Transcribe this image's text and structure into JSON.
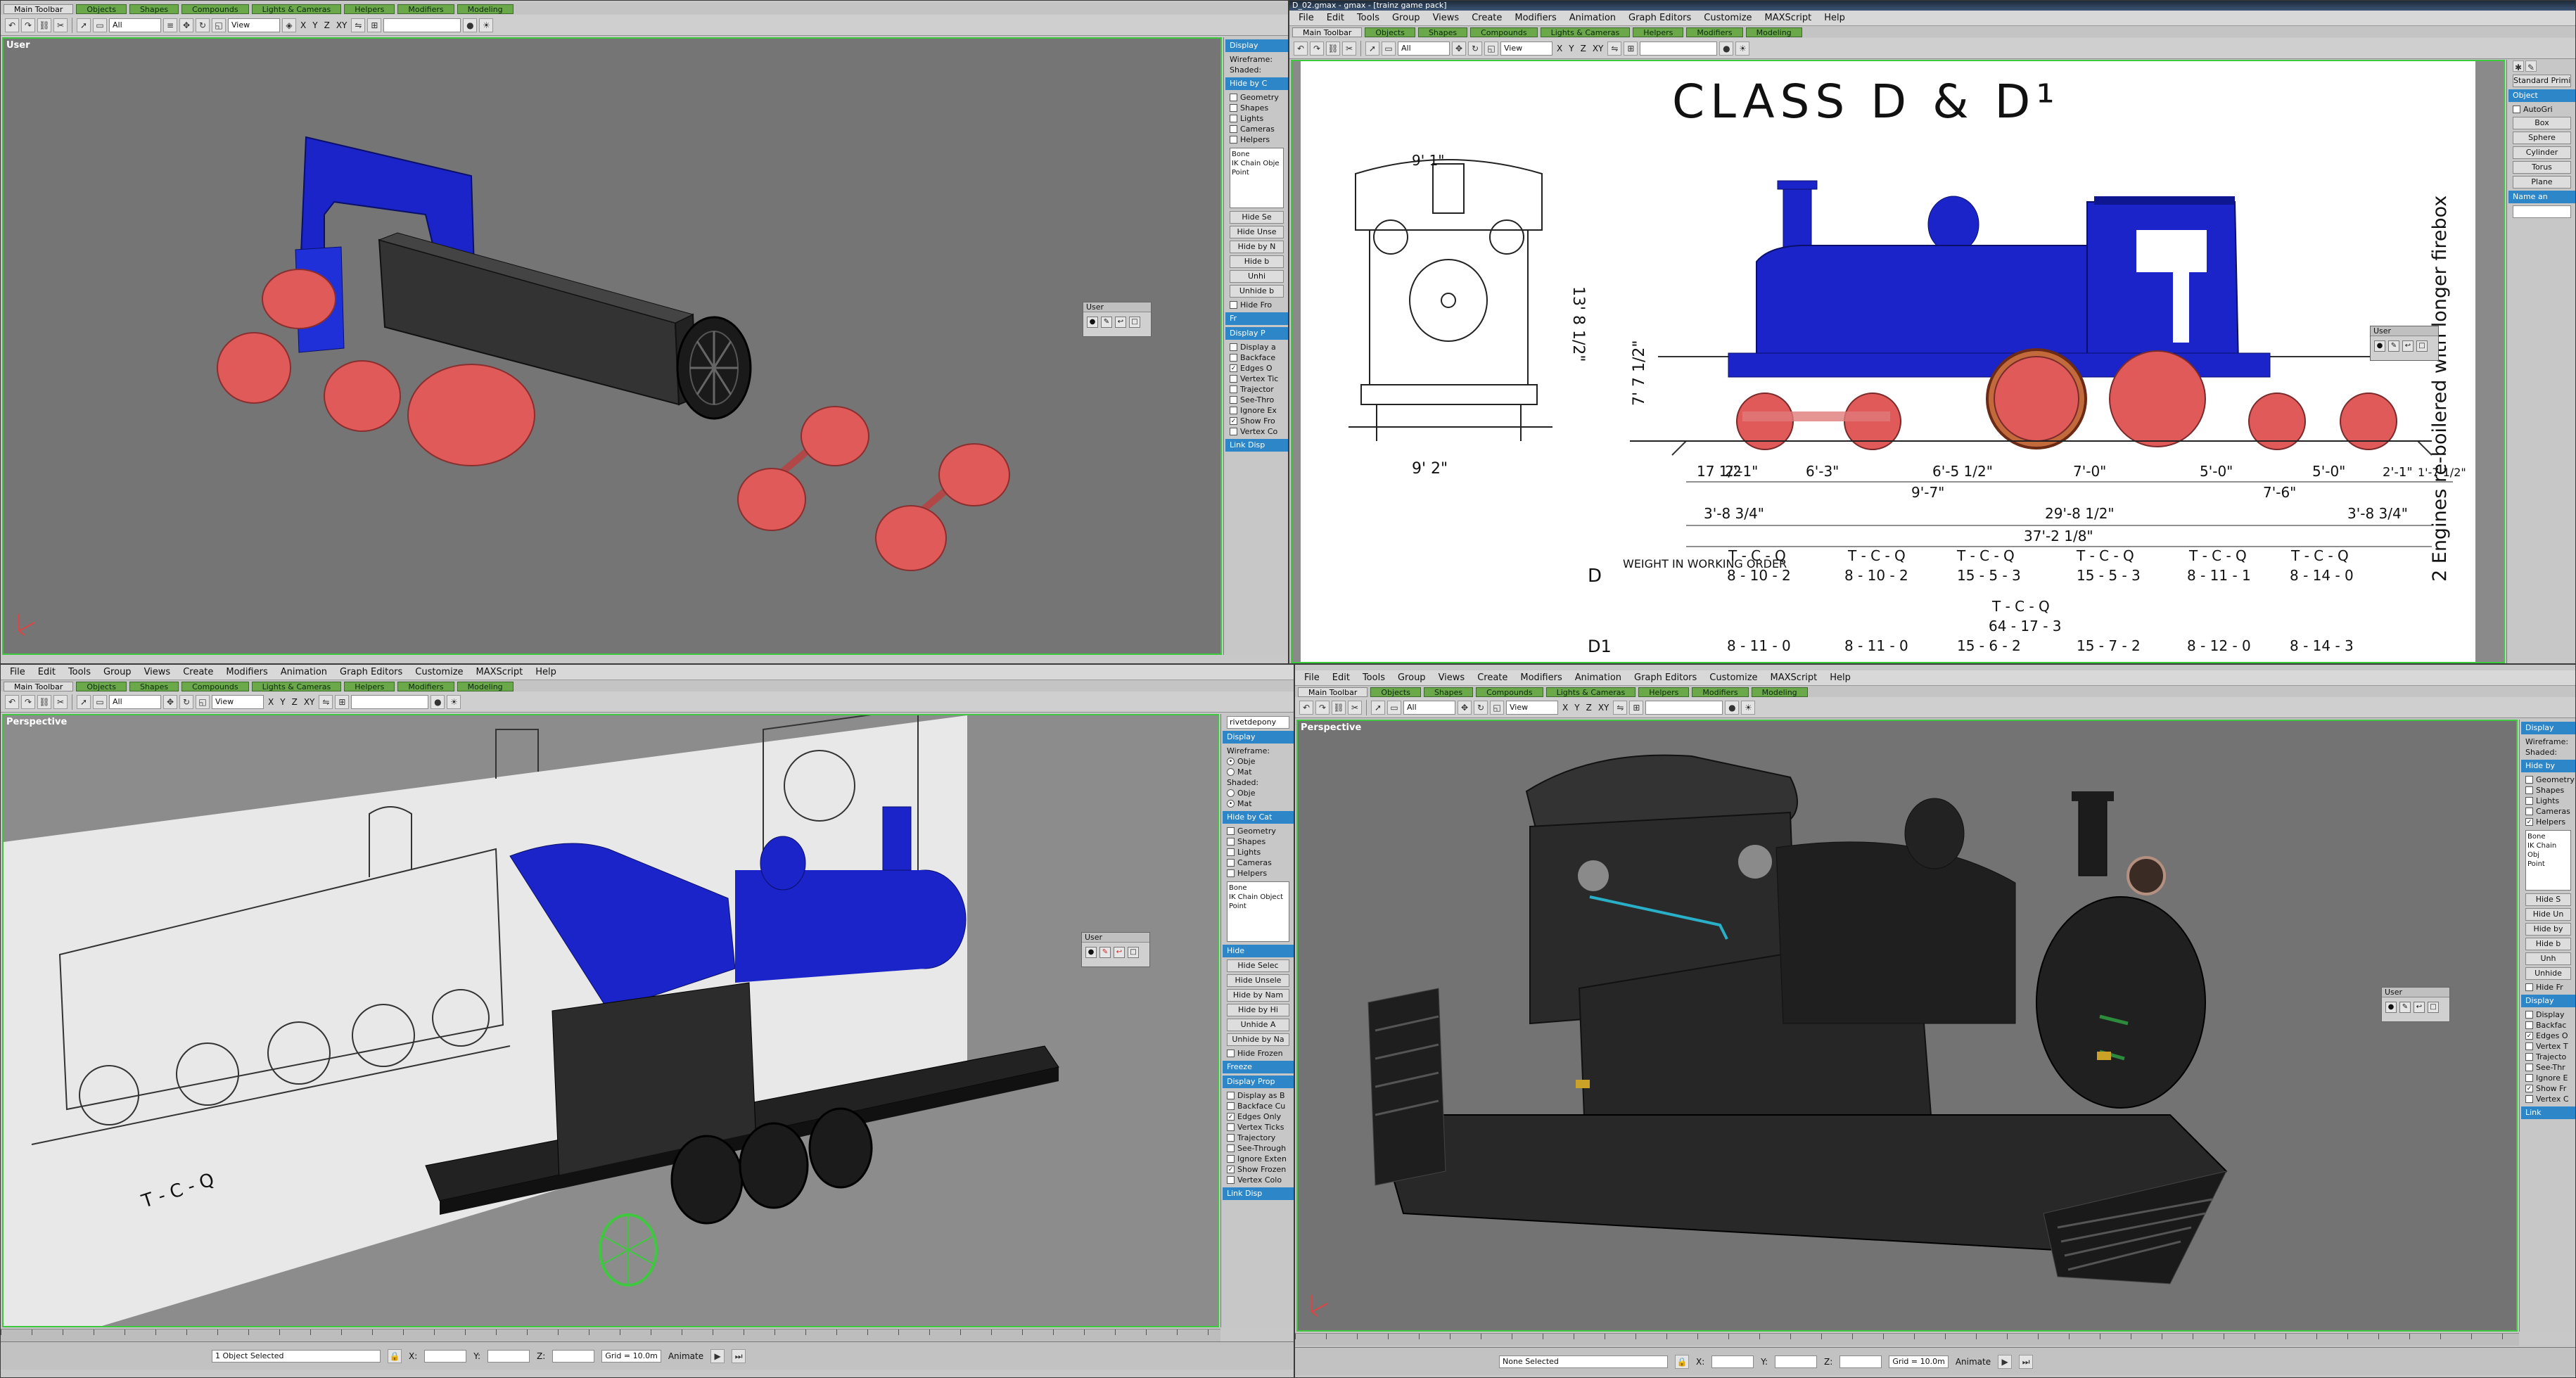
{
  "q1": {
    "tabs": [
      "Main Toolbar",
      "Objects",
      "Shapes",
      "Compounds",
      "Lights & Cameras",
      "Helpers",
      "Modifiers",
      "Modeling"
    ],
    "toolbar": {
      "filter": "All",
      "view": "View",
      "axes": [
        "X",
        "Y",
        "Z",
        "XY"
      ]
    },
    "viewport_label": "User",
    "cmd": {
      "hdr1": "Display",
      "wireframe": "Wireframe:",
      "shaded": "Shaded:",
      "hdr2": "Hide by C",
      "cats": [
        "Geometry",
        "Shapes",
        "Lights",
        "Cameras",
        "Helpers"
      ],
      "list": [
        "Bone",
        "IK Chain Obje",
        "Point"
      ],
      "buttons": [
        "Hide Se",
        "Hide Unse",
        "Hide by N",
        "Hide b",
        "Unhi",
        "Unhide b"
      ],
      "hide_frozen": "Hide Fro",
      "hdr3": "Fr",
      "hdr4": "Display P",
      "props": [
        "Display a",
        "Backface",
        "Edges O",
        "Vertex Tic",
        "Trajector",
        "See-Thro",
        "Ignore Ex",
        "Show Fro",
        "Vertex Co"
      ],
      "props_checked": [
        false,
        false,
        true,
        false,
        false,
        false,
        false,
        true,
        false
      ],
      "hdr5": "Link Disp"
    },
    "float_title": "User"
  },
  "q2": {
    "title": "D_02.gmax - gmax - [trainz game pack]",
    "menu": [
      "File",
      "Edit",
      "Tools",
      "Group",
      "Views",
      "Create",
      "Modifiers",
      "Animation",
      "Graph Editors",
      "Customize",
      "MAXScript",
      "Help"
    ],
    "tabs": [
      "Main Toolbar",
      "Objects",
      "Shapes",
      "Compounds",
      "Lights & Cameras",
      "Helpers",
      "Modifiers",
      "Modeling"
    ],
    "toolbar": {
      "filter": "All",
      "view": "View",
      "axes": [
        "X",
        "Y",
        "Z",
        "XY"
      ]
    },
    "blueprint": {
      "heading": "CLASS  D & D¹",
      "side_note": "2 Engines re-boilered with longer firebox",
      "dims_top": [
        "9' 1\"",
        "13' 8 1/2\"",
        "7' 7 1/2\"",
        "9' 2\""
      ],
      "wheelbase": [
        "17 1/2",
        "2'-1\"",
        "6'-3\"",
        "6'-5 1/2\"",
        "7'-0\"",
        "5'-0\"",
        "5'-0\"",
        "2'-1\"",
        "1'-7 1/2\""
      ],
      "lengths": [
        "9'-7\"",
        "7'-6\"",
        "3'-8 3/4\"",
        "29'-8 1/2\"",
        "37'-2 1/8\"",
        "3'-8 3/4\""
      ],
      "row_d_label": "D",
      "row_d1_label": "D1",
      "weight_label": "WEIGHT IN WORKING ORDER",
      "units": [
        "T - C - Q",
        "T - C - Q",
        "T - C - Q",
        "T - C - Q",
        "T - C - Q",
        "T - C - Q"
      ],
      "d_values": [
        "8 - 10 - 2",
        "8 - 10 - 2",
        "15 - 5 - 3",
        "15 - 5 - 3",
        "8 - 11 - 1",
        "8 - 14 - 0"
      ],
      "total_unit": "T - C - Q",
      "total": "64 - 17 - 3",
      "d1_values": [
        "8 - 11 - 0",
        "8 - 11 - 0",
        "15 - 6 - 2",
        "15 - 7 - 2",
        "8 - 12 - 0",
        "8 - 14 - 3"
      ]
    },
    "cmd": {
      "items": [
        "Standard Primit",
        "Object",
        "AutoGri",
        "Box",
        "Sphere",
        "Cylinder",
        "Torus",
        "Plane",
        "Name an"
      ]
    },
    "float_title": "User"
  },
  "q3": {
    "menu": [
      "File",
      "Edit",
      "Tools",
      "Group",
      "Views",
      "Create",
      "Modifiers",
      "Animation",
      "Graph Editors",
      "Customize",
      "MAXScript",
      "Help"
    ],
    "tabs": [
      "Main Toolbar",
      "Objects",
      "Shapes",
      "Compounds",
      "Lights & Cameras",
      "Helpers",
      "Modifiers",
      "Modeling"
    ],
    "toolbar": {
      "filter": "All",
      "view": "View",
      "axes": [
        "X",
        "Y",
        "Z",
        "XY"
      ]
    },
    "viewport_label": "Perspective",
    "cmd": {
      "name": "rivetdepony",
      "hdr1": "Display",
      "wireframe": "Wireframe:",
      "wire_opts": [
        "Obje",
        "Mat"
      ],
      "shaded": "Shaded:",
      "shaded_opts": [
        "Obje",
        "Mat"
      ],
      "hdr2": "Hide by Cat",
      "cats": [
        "Geometry",
        "Shapes",
        "Lights",
        "Cameras",
        "Helpers"
      ],
      "list": [
        "Bone",
        "IK Chain Object",
        "Point"
      ],
      "hdr3": "Hide",
      "buttons": [
        "Hide Selec",
        "Hide Unsele",
        "Hide by Nam",
        "Hide by Hi",
        "Unhide A",
        "Unhide by Na"
      ],
      "hide_frozen": "Hide Frozen",
      "hdr4": "Freeze",
      "hdr5": "Display Prop",
      "props": [
        "Display as B",
        "Backface Cu",
        "Edges Only",
        "Vertex Ticks",
        "Trajectory",
        "See-Through",
        "Ignore Exten",
        "Show Frozen",
        "Vertex Colo"
      ],
      "props_checked": [
        false,
        false,
        true,
        false,
        false,
        false,
        false,
        true,
        false
      ],
      "hdr6": "Link Disp"
    },
    "float_title": "User",
    "status": {
      "selection": "1 Object Selected",
      "x_label": "X:",
      "y_label": "Y:",
      "z_label": "Z:",
      "grid": "Grid = 10.0m",
      "animate": "Animate"
    }
  },
  "q4": {
    "menu": [
      "File",
      "Edit",
      "Tools",
      "Group",
      "Views",
      "Create",
      "Modifiers",
      "Animation",
      "Graph Editors",
      "Customize",
      "MAXScript",
      "Help"
    ],
    "tabs": [
      "Main Toolbar",
      "Objects",
      "Shapes",
      "Compounds",
      "Lights & Cameras",
      "Helpers",
      "Modifiers",
      "Modeling"
    ],
    "toolbar": {
      "filter": "All",
      "view": "View",
      "axes": [
        "X",
        "Y",
        "Z",
        "XY"
      ]
    },
    "viewport_label": "Perspective",
    "cmd": {
      "hdr1": "Display",
      "wireframe": "Wireframe:",
      "shaded": "Shaded:",
      "hdr2": "Hide by",
      "cats": [
        "Geometry",
        "Shapes",
        "Lights",
        "Cameras",
        "Helpers"
      ],
      "cats_checked": [
        false,
        false,
        false,
        false,
        true
      ],
      "list": [
        "Bone",
        "IK Chain Obj",
        "Point"
      ],
      "buttons": [
        "Hide S",
        "Hide Un",
        "Hide by",
        "Hide b",
        "Unh",
        "Unhide",
        "Hide Fr"
      ],
      "hdr3": "Display",
      "props": [
        "Display",
        "Backfac",
        "Edges O",
        "Vertex T",
        "Trajecto",
        "See-Thr",
        "Ignore E",
        "Show Fr",
        "Vertex C"
      ],
      "props_checked": [
        false,
        false,
        true,
        false,
        false,
        false,
        false,
        true,
        false
      ],
      "hdr4": "Link"
    },
    "float_title": "User",
    "status": {
      "selection": "None Selected",
      "x_label": "X:",
      "y_label": "Y:",
      "z_label": "Z:",
      "grid": "Grid = 10.0m",
      "animate": "Animate"
    }
  },
  "colors": {
    "viewport_grey": "#737373",
    "blue_model": "#1a24c8",
    "red_wheel": "#e05a5a",
    "active_border": "#3fc83f",
    "hdr_blue": "#2d86c8"
  }
}
